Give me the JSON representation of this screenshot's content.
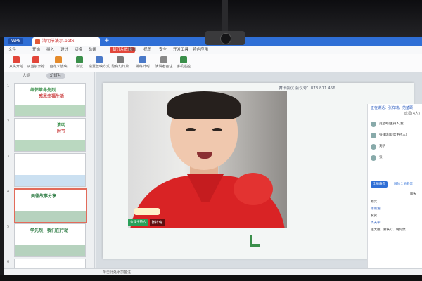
{
  "browser": {
    "app_badge": "WPS",
    "doc_tab": "清明节演示.pptx",
    "new_tab": "+"
  },
  "menu": {
    "items": [
      "文件",
      "开始",
      "插入",
      "设计",
      "切换",
      "动画",
      "幻灯片放映",
      "审阅",
      "视图",
      "安全",
      "开发工具",
      "特色应用"
    ],
    "active": "幻灯片放映"
  },
  "toolbar": {
    "items": [
      {
        "label": "从头开始",
        "color": "#e2463a"
      },
      {
        "label": "从当前开始",
        "color": "#e2463a"
      },
      {
        "label": "自定义放映",
        "color": "#e58b2b"
      },
      {
        "label": "会议",
        "color": "#3a8f4a"
      },
      {
        "label": "设置放映方式",
        "color": "#4a79c8"
      },
      {
        "label": "隐藏幻灯片",
        "color": "#7b7b7b"
      },
      {
        "label": "排练计时",
        "color": "#4a79c8"
      },
      {
        "label": "演讲者备注",
        "color": "#888888"
      },
      {
        "label": "手机遥控",
        "color": "#3a8f4a"
      }
    ]
  },
  "panel": {
    "tabs": [
      "大纲",
      "幻灯片"
    ],
    "active_tab": "幻灯片",
    "slides": [
      {
        "num": "1",
        "title": "缅怀革命先烈",
        "subtitle": "感恩幸福生活",
        "accent": "#3a8f4a"
      },
      {
        "num": "2",
        "title": "清明",
        "subtitle": "时节",
        "accent": "#3a8f4a"
      },
      {
        "num": "3",
        "title": "",
        "subtitle": "",
        "accent": "#6aa7d8"
      },
      {
        "num": "4",
        "title": "美德故事分享",
        "subtitle": "",
        "accent": "#2f7d45"
      },
      {
        "num": "5",
        "title": "学先烈，我们在行动",
        "subtitle": "",
        "accent": "#2f7d45"
      },
      {
        "num": "6",
        "title": "",
        "subtitle": "",
        "accent": "#6aa7d8"
      }
    ]
  },
  "meeting": {
    "id_text": "腾讯会议 会议号：873 811 456",
    "host_tag": "会议主持人",
    "participant_name": "张祥瑞"
  },
  "side_panel": {
    "header": "正在讲话：张祥瑞，范楚颐",
    "count": "成员(4人)",
    "members": [
      "范楚颐(主持人,我)",
      "张祥瑞(联席主持人)",
      "刘伊",
      "张"
    ],
    "btn_invite": "全员静音",
    "btn_unmute": "解除全员静音",
    "chat_title": "聊天",
    "chat_lines": [
      "畅元",
      "谢雨涵",
      "祝贺",
      "周天宇",
      "张大雁、蒙铁刀、柯何然"
    ]
  },
  "status": {
    "text": "单击此处添加备注"
  }
}
